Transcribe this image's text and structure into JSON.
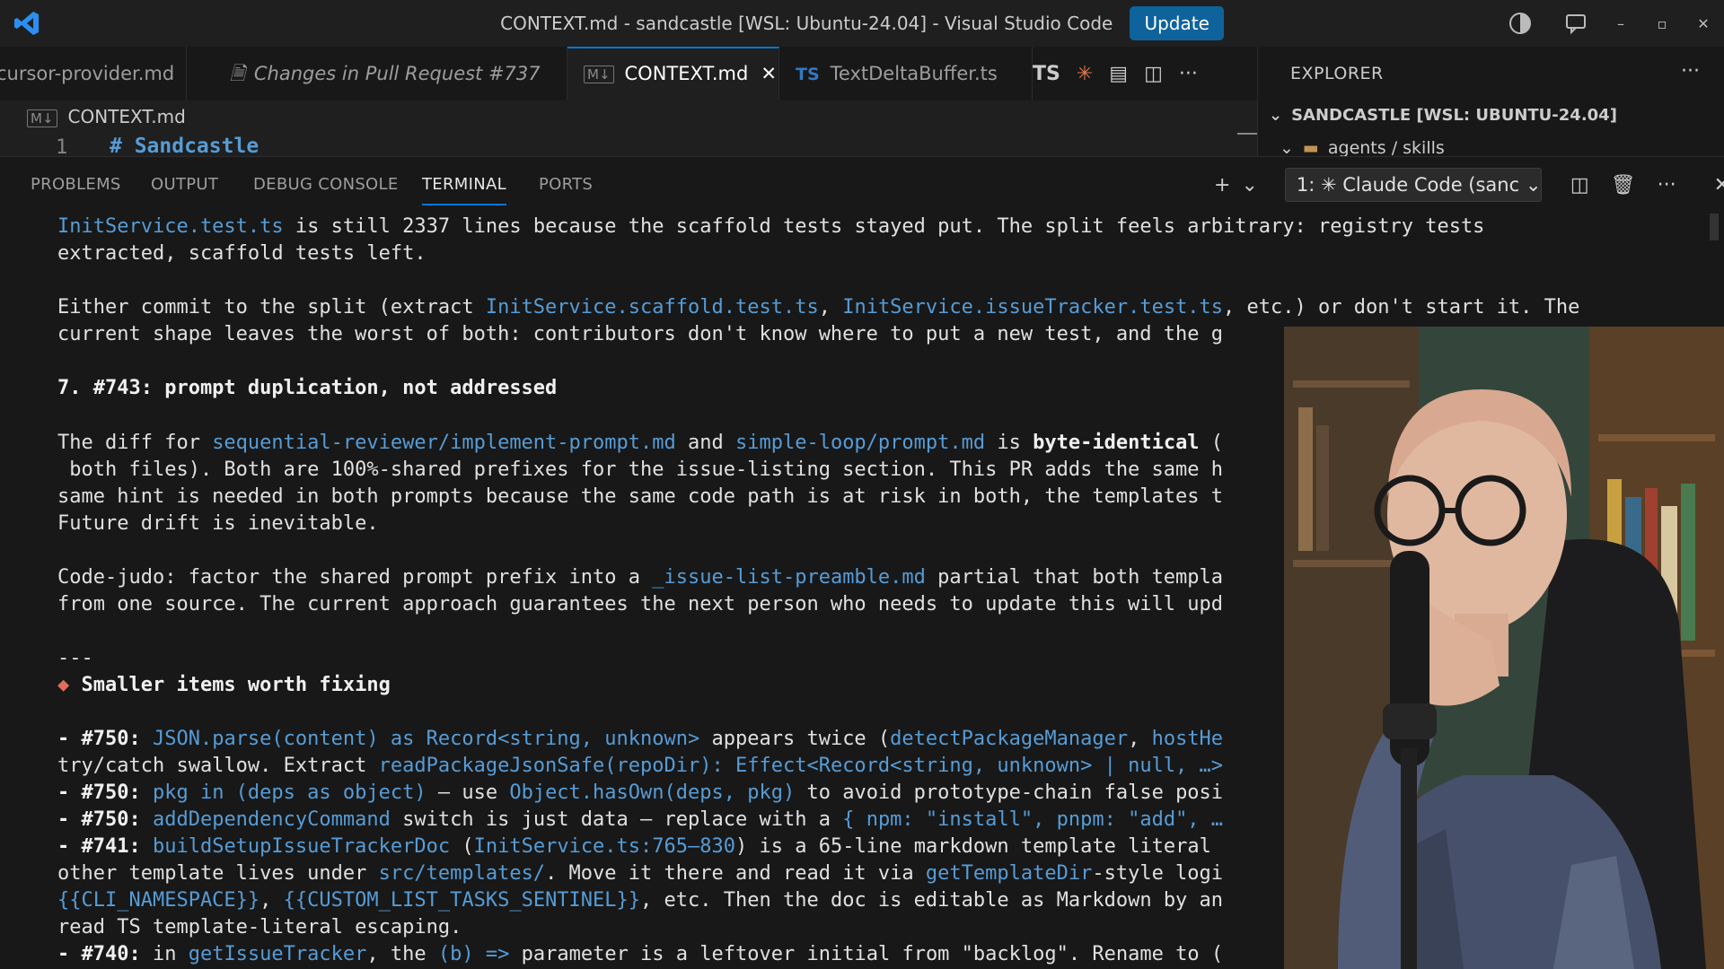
{
  "titlebar": {
    "title": "CONTEXT.md - sandcastle [WSL: Ubuntu-24.04] - Visual Studio Code",
    "update_label": "Update"
  },
  "tabs": [
    {
      "label": "cursor-provider.md",
      "kind": "md",
      "active": false
    },
    {
      "label": "Changes in Pull Request #737",
      "kind": "diff",
      "active": false
    },
    {
      "label": "CONTEXT.md",
      "kind": "md",
      "active": true
    },
    {
      "label": "TextDeltaBuffer.ts",
      "kind": "ts",
      "active": false
    }
  ],
  "tab_actions": {
    "ts_label": "TS"
  },
  "explorer": {
    "title": "EXPLORER",
    "root": "SANDCASTLE [WSL: UBUNTU-24.04]",
    "sub": "agents / skills"
  },
  "editor": {
    "breadcrumb": "CONTEXT.md",
    "line_number": "1",
    "line_text": "# Sandcastle"
  },
  "panel": {
    "tabs": [
      "PROBLEMS",
      "OUTPUT",
      "DEBUG CONSOLE",
      "TERMINAL",
      "PORTS"
    ],
    "active_tab": "TERMINAL",
    "terminal_name": "1: ✳ Claude Code (sanc"
  },
  "terminal": {
    "l1a": "InitService.test.ts",
    "l1b": " is still 2337 lines because the scaffold tests stayed put. The split feels arbitrary: registry tests",
    "l2": "extracted, scaffold tests left.",
    "l3a": "Either commit to the split (extract ",
    "l3b": "InitService.scaffold.test.ts",
    "l3c": ", ",
    "l3d": "InitService.issueTracker.test.ts",
    "l3e": ", etc.) or don't start it. The",
    "l4": "current shape leaves the worst of both: contributors don't know where to put a new test, and the g",
    "l5": "7. #743: prompt duplication, not addressed",
    "l6a": "The diff for ",
    "l6b": "sequential-reviewer/implement-prompt.md",
    "l6c": " and ",
    "l6d": "simple-loop/prompt.md",
    "l6e": " is ",
    "l6f": "byte-identical",
    "l6g": " (",
    "l7": " both files). Both are 100%-shared prefixes for the issue-listing section. This PR adds the same h",
    "l8": "same hint is needed in both prompts because the same code path is at risk in both, the templates t",
    "l9": "Future drift is inevitable.",
    "l10a": "Code-judo: factor the shared prompt prefix into a ",
    "l10b": "_issue-list-preamble.md",
    "l10c": " partial that both templa",
    "l11": "from one source. The current approach guarantees the next person who needs to update this will upd",
    "l12": "---",
    "l13a": "◆",
    "l13b": " Smaller items worth fixing",
    "l14a": "- #750:",
    "l14b": " ",
    "l14c": "JSON.parse(content) as Record<string, unknown>",
    "l14d": " appears twice (",
    "l14e": "detectPackageManager",
    "l14f": ", ",
    "l14g": "hostHe",
    "l15a": "try/catch swallow. Extract ",
    "l15b": "readPackageJsonSafe(repoDir): Effect<Record<string, unknown> | null, …>",
    "l16a": "- #750:",
    "l16b": " ",
    "l16c": "pkg in (deps as object)",
    "l16d": " — use ",
    "l16e": "Object.hasOwn(deps, pkg)",
    "l16f": " to avoid prototype-chain false posi",
    "l17a": "- #750:",
    "l17b": " ",
    "l17c": "addDependencyCommand",
    "l17d": " switch is just data — replace with a ",
    "l17e": "{ npm: \"install\", pnpm: \"add\", …",
    "l18a": "- #741:",
    "l18b": " ",
    "l18c": "buildSetupIssueTrackerDoc",
    "l18d": " (",
    "l18e": "InitService.ts:765–830",
    "l18f": ") is a 65-line markdown template literal",
    "l19a": "other template lives under ",
    "l19b": "src/templates/",
    "l19c": ". Move it there and read it via ",
    "l19d": "getTemplateDir",
    "l19e": "-style logi",
    "l20a": "{{CLI_NAMESPACE}}",
    "l20b": ", ",
    "l20c": "{{CUSTOM_LIST_TASKS_SENTINEL}}",
    "l20d": ", etc. Then the doc is editable as Markdown by an",
    "l21": "read TS template-literal escaping.",
    "l22a": "- #740:",
    "l22b": " in ",
    "l22c": "getIssueTracker",
    "l22d": ", the ",
    "l22e": "(b) =>",
    "l22f": " parameter is a leftover initial from \"backlog\". Rename to ("
  },
  "colors": {
    "accent": "#0078d4",
    "code": "#569cd6",
    "diamond": "#e06c5a",
    "update_button": "#0e639c"
  },
  "icons": [
    "vscode-logo-icon",
    "copilot-icon",
    "feedback-icon",
    "minimize-icon",
    "maximize-icon",
    "close-icon",
    "claude-icon",
    "preview-icon",
    "split-editor-icon",
    "more-icon",
    "plus-icon",
    "chevron-down-icon",
    "split-terminal-icon",
    "trash-icon"
  ]
}
